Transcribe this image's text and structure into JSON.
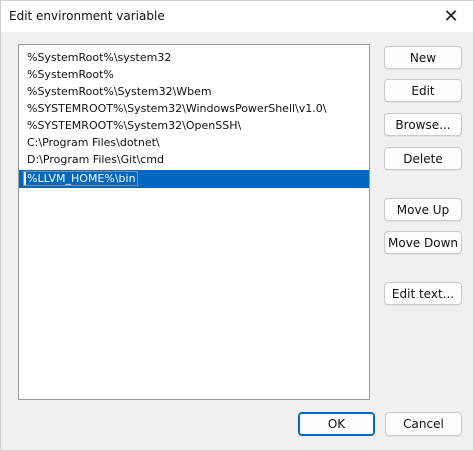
{
  "window": {
    "title": "Edit environment variable",
    "close_glyph": "✕",
    "close_icon": "close-icon"
  },
  "list": {
    "items": [
      "%SystemRoot%\\system32",
      "%SystemRoot%",
      "%SystemRoot%\\System32\\Wbem",
      "%SYSTEMROOT%\\System32\\WindowsPowerShell\\v1.0\\",
      "%SYSTEMROOT%\\System32\\OpenSSH\\",
      "C:\\Program Files\\dotnet\\",
      "D:\\Program Files\\Git\\cmd"
    ],
    "editing_value": "%LLVM_HOME%\\bin"
  },
  "buttons": {
    "new": "New",
    "edit": "Edit",
    "browse": "Browse...",
    "delete": "Delete",
    "move_up": "Move Up",
    "move_down": "Move Down",
    "edit_text": "Edit text...",
    "ok": "OK",
    "cancel": "Cancel"
  },
  "colors": {
    "selection": "#0067c0",
    "window_bg": "#f0f0f0",
    "list_bg": "#ffffff"
  }
}
